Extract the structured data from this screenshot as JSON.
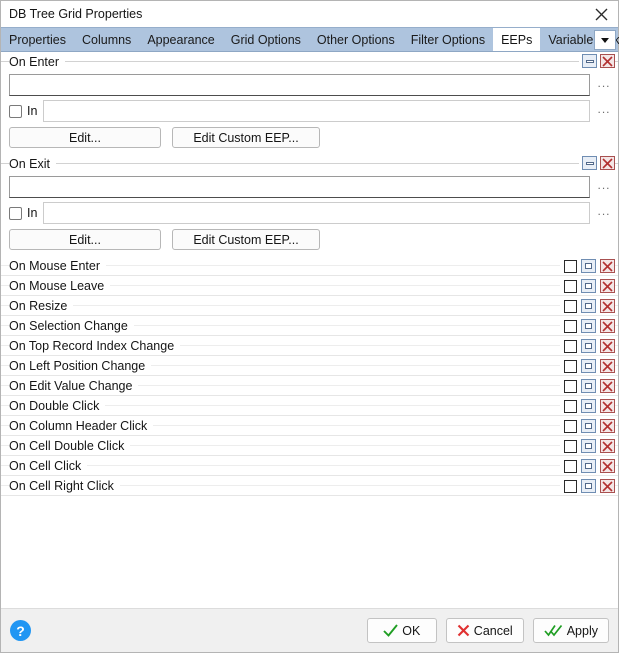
{
  "window": {
    "title": "DB Tree Grid Properties",
    "close_icon": "close-icon"
  },
  "tabs": {
    "items": [
      {
        "label": "Properties",
        "selected": false
      },
      {
        "label": "Columns",
        "selected": false
      },
      {
        "label": "Appearance",
        "selected": false
      },
      {
        "label": "Grid Options",
        "selected": false
      },
      {
        "label": "Other Options",
        "selected": false
      },
      {
        "label": "Filter Options",
        "selected": false
      },
      {
        "label": "EEPs",
        "selected": true
      },
      {
        "label": "Variable Links",
        "selected": false
      }
    ],
    "overflow_icon": "chevron-down-icon"
  },
  "groups": [
    {
      "title": "On Enter",
      "minimize_icon": "minimize-icon",
      "close_icon": "close-icon",
      "main_field_value": "",
      "main_field_placeholder": "",
      "ellipsis_label": "...",
      "in_checkbox_checked": false,
      "in_label": "In",
      "in_field_value": "",
      "in_ellipsis_label": "...",
      "edit_button": "Edit...",
      "edit_custom_button": "Edit Custom EEP..."
    },
    {
      "title": "On Exit",
      "minimize_icon": "minimize-icon",
      "close_icon": "close-icon",
      "main_field_value": "",
      "main_field_placeholder": "",
      "ellipsis_label": "...",
      "in_checkbox_checked": false,
      "in_label": "In",
      "in_field_value": "",
      "in_ellipsis_label": "...",
      "edit_button": "Edit...",
      "edit_custom_button": "Edit Custom EEP..."
    }
  ],
  "events": [
    {
      "label": "On Mouse Enter",
      "checked": false
    },
    {
      "label": "On Mouse Leave",
      "checked": false
    },
    {
      "label": "On Resize",
      "checked": false
    },
    {
      "label": "On Selection Change",
      "checked": false
    },
    {
      "label": "On Top Record Index Change",
      "checked": false
    },
    {
      "label": "On Left Position Change",
      "checked": false
    },
    {
      "label": "On Edit Value Change",
      "checked": false
    },
    {
      "label": "On Double Click",
      "checked": false
    },
    {
      "label": "On Column Header Click",
      "checked": false
    },
    {
      "label": "On Cell Double Click",
      "checked": false
    },
    {
      "label": "On Cell Click",
      "checked": false
    },
    {
      "label": "On Cell Right Click",
      "checked": false
    }
  ],
  "event_row_icons": {
    "restore_icon": "restore-icon",
    "close_icon": "close-icon"
  },
  "footer": {
    "help_label": "?",
    "ok_label": "OK",
    "cancel_label": "Cancel",
    "apply_label": "Apply",
    "ok_icon": "check-icon",
    "cancel_icon": "cross-icon",
    "apply_icon": "double-check-icon"
  },
  "colors": {
    "tabstrip": "#aec4de",
    "accent_blue": "#2196f3",
    "ok_green": "#1f9e23",
    "cancel_red": "#e03030",
    "icon_blue_border": "#6f8db2",
    "icon_red_border": "#a85050"
  }
}
